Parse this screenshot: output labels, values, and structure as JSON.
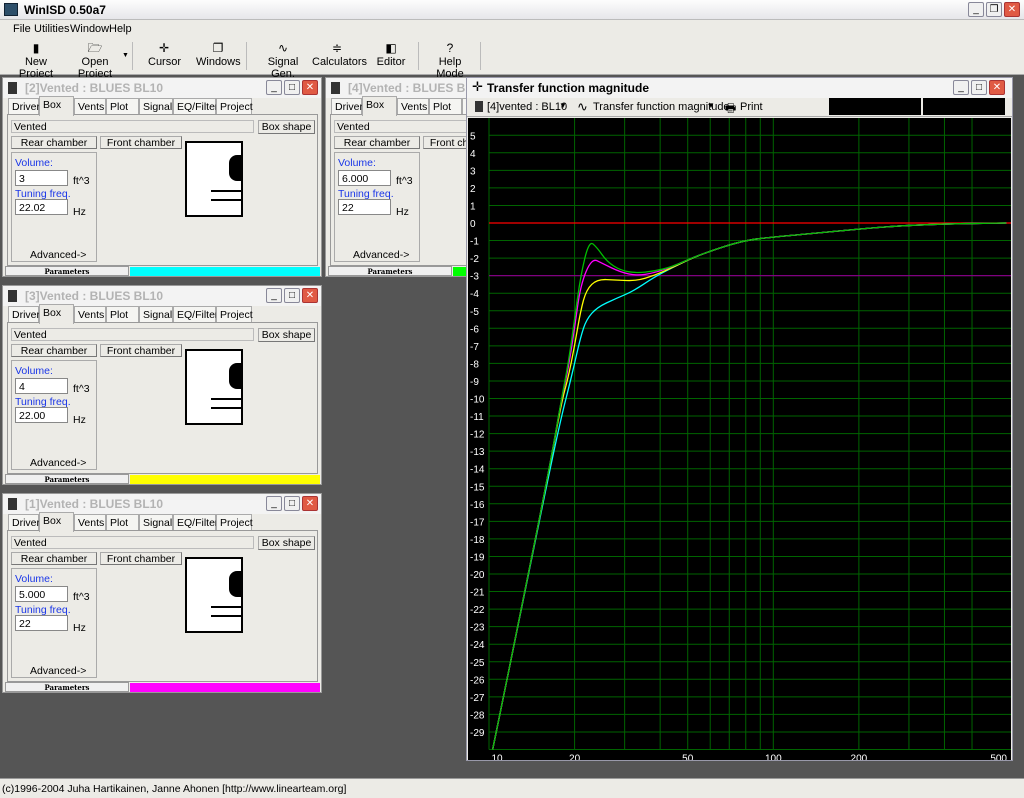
{
  "app": {
    "title": "WinISD 0.50a7",
    "status": "(c)1996-2004 Juha Hartikainen, Janne Ahonen [http://www.linearteam.org]"
  },
  "menu": [
    "File",
    "Utilities",
    "Window",
    "Help"
  ],
  "toolbar": [
    {
      "label": "New Project",
      "icon": "new-project-icon",
      "glyph": "▮"
    },
    {
      "label": "Open Project",
      "icon": "open-folder-icon",
      "glyph": "🗁"
    },
    {
      "label": "Cursor",
      "icon": "cursor-icon",
      "glyph": "✛"
    },
    {
      "label": "Windows",
      "icon": "windows-icon",
      "glyph": "❐"
    },
    {
      "label": "Signal Gen.",
      "icon": "signal-wave-icon",
      "glyph": "∿"
    },
    {
      "label": "Calculators",
      "icon": "calculator-icon",
      "glyph": "≑"
    },
    {
      "label": "Editor",
      "icon": "editor-icon",
      "glyph": "◧"
    },
    {
      "label": "Help Mode",
      "icon": "help-icon",
      "glyph": "?"
    }
  ],
  "project_windows": [
    {
      "title": "[2]Vented : BLUES BL10",
      "box_type": "Vented",
      "volume": "3",
      "tuning": "22.02",
      "color": "#00ffff"
    },
    {
      "title": "[3]Vented : BLUES BL10",
      "box_type": "Vented",
      "volume": "4",
      "tuning": "22.00",
      "color": "#ffff00"
    },
    {
      "title": "[1]Vented : BLUES BL10",
      "box_type": "Vented",
      "volume": "5.000",
      "tuning": "22",
      "color": "#ff00ff"
    },
    {
      "title": "[4]Vented : BLUES BL10",
      "box_type": "Vented",
      "volume": "6.000",
      "tuning": "22",
      "color": "#00ff00"
    }
  ],
  "window_labels": {
    "tabs": [
      "Driver",
      "Box",
      "Vents",
      "Plot",
      "Signal",
      "EQ/Filter",
      "Project"
    ],
    "box_shape": "Box shape",
    "rear": "Rear chamber",
    "front": "Front chamber",
    "volume": "Volume:",
    "volume_unit": "ft^3",
    "tuning": "Tuning freq.",
    "tuning_unit": "Hz",
    "advanced": "Advanced->",
    "parameters": "Parameters"
  },
  "plot": {
    "title": "Transfer function magnitude",
    "project_select": "[4]vented : BL10",
    "graph_select": "Transfer function magnitude",
    "print": "Print"
  },
  "chart_data": {
    "type": "line",
    "xscale": "log",
    "xlim": [
      10,
      660
    ],
    "ylim": [
      -30,
      6
    ],
    "xticks": [
      10,
      20,
      50,
      100,
      200,
      500
    ],
    "yticks": [
      5,
      4,
      3,
      2,
      1,
      0,
      -1,
      -2,
      -3,
      -4,
      -5,
      -6,
      -7,
      -8,
      -9,
      -10,
      -11,
      -12,
      -13,
      -14,
      -15,
      -16,
      -17,
      -18,
      -19,
      -20,
      -21,
      -22,
      -23,
      -24,
      -25,
      -26,
      -27,
      -28,
      -29
    ],
    "xgrid": [
      10,
      20,
      30,
      40,
      50,
      60,
      70,
      80,
      90,
      100,
      200,
      300,
      400,
      500
    ],
    "grid": true,
    "grid_color": "#006400",
    "background": "#000000",
    "reference_lines": [
      {
        "y": 0,
        "color": "#ff0000"
      },
      {
        "y": -3,
        "color": "#800080"
      }
    ],
    "series": [
      {
        "color": "#00ffff",
        "x": [
          10.3,
          13,
          16.3,
          18,
          19,
          20,
          21,
          22,
          24,
          28,
          32,
          38,
          44,
          55,
          78,
          100,
          160,
          250,
          400,
          660
        ],
        "y": [
          -30,
          -22,
          -14.2,
          -11,
          -9.5,
          -8,
          -6.5,
          -5.5,
          -4.8,
          -4.3,
          -3.9,
          -3.1,
          -2.55,
          -1.8,
          -1.0,
          -0.8,
          -0.5,
          -0.2,
          -0.05,
          0
        ]
      },
      {
        "color": "#ffff00",
        "x": [
          10.3,
          13,
          16.3,
          18,
          19,
          20,
          21,
          22,
          24,
          28,
          33,
          38,
          44,
          55,
          78,
          100,
          160,
          250,
          400,
          660
        ],
        "y": [
          -30,
          -22,
          -14,
          -10.2,
          -8.8,
          -7,
          -5,
          -3.8,
          -3.2,
          -3.25,
          -3.3,
          -3.0,
          -2.55,
          -1.8,
          -1.0,
          -0.8,
          -0.5,
          -0.2,
          -0.05,
          0
        ]
      },
      {
        "color": "#ff00ff",
        "x": [
          10.3,
          13,
          16.3,
          18,
          19,
          20,
          21,
          23,
          25,
          29,
          33,
          38,
          44,
          55,
          78,
          100,
          160,
          250,
          400,
          660
        ],
        "y": [
          -30,
          -22,
          -14,
          -10,
          -8.3,
          -6,
          -3.5,
          -2,
          -2.3,
          -2.8,
          -3.0,
          -2.85,
          -2.5,
          -1.8,
          -1.0,
          -0.8,
          -0.5,
          -0.2,
          -0.05,
          0
        ]
      },
      {
        "color": "#00c000",
        "x": [
          10.3,
          13,
          16.3,
          18,
          19,
          20,
          21,
          22.5,
          24,
          26,
          29,
          33,
          38,
          44,
          55,
          78,
          100,
          160,
          250,
          400,
          660
        ],
        "y": [
          -30,
          -22,
          -14,
          -10,
          -8,
          -5.5,
          -3,
          -1,
          -1.4,
          -2.2,
          -2.7,
          -2.85,
          -2.75,
          -2.5,
          -1.8,
          -1.0,
          -0.8,
          -0.5,
          -0.2,
          -0.05,
          0
        ]
      }
    ]
  }
}
